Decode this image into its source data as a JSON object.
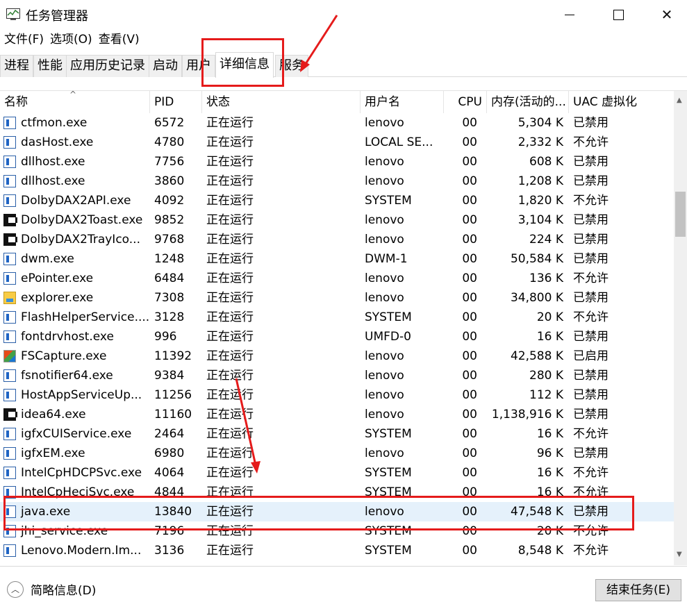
{
  "window": {
    "title": "任务管理器",
    "icon": "task-manager-icon",
    "controls": {
      "minimize": "minimize-icon",
      "maximize": "maximize-icon",
      "close": "✕"
    }
  },
  "menu": [
    "文件(F)",
    "选项(O)",
    "查看(V)"
  ],
  "tabs": [
    {
      "label": "进程",
      "active": false
    },
    {
      "label": "性能",
      "active": false
    },
    {
      "label": "应用历史记录",
      "active": false
    },
    {
      "label": "启动",
      "active": false
    },
    {
      "label": "用户",
      "active": false
    },
    {
      "label": "详细信息",
      "active": true
    },
    {
      "label": "服务",
      "active": false
    }
  ],
  "columns": {
    "name": "名称",
    "pid": "PID",
    "status": "状态",
    "user": "用户名",
    "cpu": "CPU",
    "mem": "内存(活动的...",
    "uac": "UAC 虚拟化",
    "sort_indicator": "^"
  },
  "rows": [
    {
      "name": "ctfmon.exe",
      "pid": "6572",
      "status": "正在运行",
      "user": "lenovo",
      "cpu": "00",
      "mem": "5,304 K",
      "uac": "已禁用",
      "icon": "pen-icon"
    },
    {
      "name": "dasHost.exe",
      "pid": "4780",
      "status": "正在运行",
      "user": "LOCAL SE...",
      "cpu": "00",
      "mem": "2,332 K",
      "uac": "不允许",
      "icon": "app-window-icon"
    },
    {
      "name": "dllhost.exe",
      "pid": "7756",
      "status": "正在运行",
      "user": "lenovo",
      "cpu": "00",
      "mem": "608 K",
      "uac": "已禁用",
      "icon": "app-window-icon"
    },
    {
      "name": "dllhost.exe",
      "pid": "3860",
      "status": "正在运行",
      "user": "lenovo",
      "cpu": "00",
      "mem": "1,208 K",
      "uac": "已禁用",
      "icon": "app-window-icon"
    },
    {
      "name": "DolbyDAX2API.exe",
      "pid": "4092",
      "status": "正在运行",
      "user": "SYSTEM",
      "cpu": "00",
      "mem": "1,820 K",
      "uac": "不允许",
      "icon": "app-window-icon"
    },
    {
      "name": "DolbyDAX2Toast.exe",
      "pid": "9852",
      "status": "正在运行",
      "user": "lenovo",
      "cpu": "00",
      "mem": "3,104 K",
      "uac": "已禁用",
      "icon": "dolby-icon"
    },
    {
      "name": "DolbyDAX2TrayIco...",
      "pid": "9768",
      "status": "正在运行",
      "user": "lenovo",
      "cpu": "00",
      "mem": "224 K",
      "uac": "已禁用",
      "icon": "dolby-icon"
    },
    {
      "name": "dwm.exe",
      "pid": "1248",
      "status": "正在运行",
      "user": "DWM-1",
      "cpu": "00",
      "mem": "50,584 K",
      "uac": "已禁用",
      "icon": "app-window-icon"
    },
    {
      "name": "ePointer.exe",
      "pid": "6484",
      "status": "正在运行",
      "user": "lenovo",
      "cpu": "00",
      "mem": "136 K",
      "uac": "不允许",
      "icon": "pen-icon"
    },
    {
      "name": "explorer.exe",
      "pid": "7308",
      "status": "正在运行",
      "user": "lenovo",
      "cpu": "00",
      "mem": "34,800 K",
      "uac": "已禁用",
      "icon": "folder-icon"
    },
    {
      "name": "FlashHelperService....",
      "pid": "3128",
      "status": "正在运行",
      "user": "SYSTEM",
      "cpu": "00",
      "mem": "20 K",
      "uac": "不允许",
      "icon": "app-window-icon"
    },
    {
      "name": "fontdrvhost.exe",
      "pid": "996",
      "status": "正在运行",
      "user": "UMFD-0",
      "cpu": "00",
      "mem": "16 K",
      "uac": "已禁用",
      "icon": "app-window-icon"
    },
    {
      "name": "FSCapture.exe",
      "pid": "11392",
      "status": "正在运行",
      "user": "lenovo",
      "cpu": "00",
      "mem": "42,588 K",
      "uac": "已启用",
      "icon": "fscapture-icon"
    },
    {
      "name": "fsnotifier64.exe",
      "pid": "9384",
      "status": "正在运行",
      "user": "lenovo",
      "cpu": "00",
      "mem": "280 K",
      "uac": "已禁用",
      "icon": "app-window-icon"
    },
    {
      "name": "HostAppServiceUp...",
      "pid": "11256",
      "status": "正在运行",
      "user": "lenovo",
      "cpu": "00",
      "mem": "112 K",
      "uac": "已禁用",
      "icon": "app-window-icon"
    },
    {
      "name": "idea64.exe",
      "pid": "11160",
      "status": "正在运行",
      "user": "lenovo",
      "cpu": "00",
      "mem": "1,138,916 K",
      "uac": "已禁用",
      "icon": "intellij-icon"
    },
    {
      "name": "igfxCUIService.exe",
      "pid": "2464",
      "status": "正在运行",
      "user": "SYSTEM",
      "cpu": "00",
      "mem": "16 K",
      "uac": "不允许",
      "icon": "app-window-icon"
    },
    {
      "name": "igfxEM.exe",
      "pid": "6980",
      "status": "正在运行",
      "user": "lenovo",
      "cpu": "00",
      "mem": "96 K",
      "uac": "已禁用",
      "icon": "intel-graphics-icon"
    },
    {
      "name": "IntelCpHDCPSvc.exe",
      "pid": "4064",
      "status": "正在运行",
      "user": "SYSTEM",
      "cpu": "00",
      "mem": "16 K",
      "uac": "不允许",
      "icon": "app-window-icon"
    },
    {
      "name": "IntelCpHeciSvc.exe",
      "pid": "4844",
      "status": "正在运行",
      "user": "SYSTEM",
      "cpu": "00",
      "mem": "16 K",
      "uac": "不允许",
      "icon": "app-window-icon"
    },
    {
      "name": "java.exe",
      "pid": "13840",
      "status": "正在运行",
      "user": "lenovo",
      "cpu": "00",
      "mem": "47,548 K",
      "uac": "已禁用",
      "icon": "java-icon",
      "selected": true
    },
    {
      "name": "jhi_service.exe",
      "pid": "7196",
      "status": "正在运行",
      "user": "SYSTEM",
      "cpu": "00",
      "mem": "20 K",
      "uac": "不允许",
      "icon": "app-window-icon"
    },
    {
      "name": "Lenovo.Modern.Im...",
      "pid": "3136",
      "status": "正在运行",
      "user": "SYSTEM",
      "cpu": "00",
      "mem": "8,548 K",
      "uac": "不允许",
      "icon": "app-window-icon"
    }
  ],
  "footer": {
    "brief_label": "简略信息(D)",
    "end_task_label": "结束任务(E)"
  },
  "annotation_color": "#e51b1b"
}
